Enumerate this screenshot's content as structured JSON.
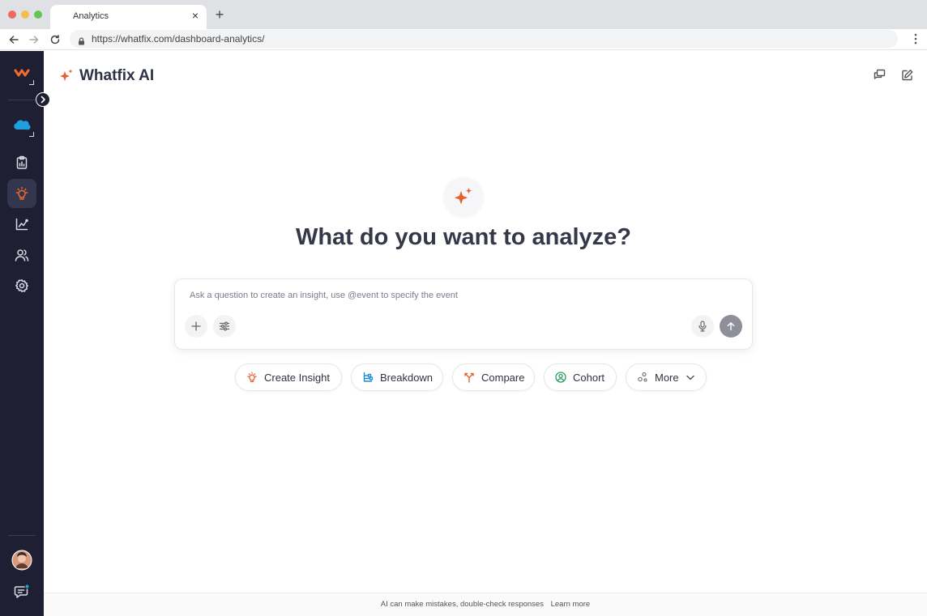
{
  "browser": {
    "tab_title": "Analytics",
    "close_glyph": "×",
    "new_tab_glyph": "+",
    "url": "https://whatfix.com/dashboard-analytics/"
  },
  "sidebar": {
    "items": [
      {
        "icon": "whatfix-logo-icon"
      },
      {
        "icon": "salesforce-cloud-icon"
      },
      {
        "icon": "clipboard-chart-icon"
      },
      {
        "icon": "lightbulb-icon",
        "active": true
      },
      {
        "icon": "line-chart-icon"
      },
      {
        "icon": "users-icon"
      },
      {
        "icon": "gear-icon"
      }
    ],
    "bottom": [
      {
        "icon": "avatar"
      },
      {
        "icon": "chat-icon"
      }
    ]
  },
  "header": {
    "title": "Whatfix AI"
  },
  "hero": {
    "title": "What do you want to analyze?"
  },
  "composer": {
    "value": "",
    "placeholder": "Ask a question to create an insight, use @event to specify the event"
  },
  "chips": [
    {
      "label": "Create Insight",
      "icon": "lightbulb-icon"
    },
    {
      "label": "Breakdown",
      "icon": "hierarchy-icon"
    },
    {
      "label": "Compare",
      "icon": "fork-icon"
    },
    {
      "label": "Cohort",
      "icon": "user-circle-icon"
    },
    {
      "label": "More",
      "icon": "dots-icon"
    }
  ],
  "footer": {
    "disclaimer": "AI can make mistakes, double-check responses",
    "link": "Learn more"
  },
  "colors": {
    "accent": "#e5602a",
    "sidebar_bg": "#1e1f33",
    "send_button": "#8e8f99"
  }
}
